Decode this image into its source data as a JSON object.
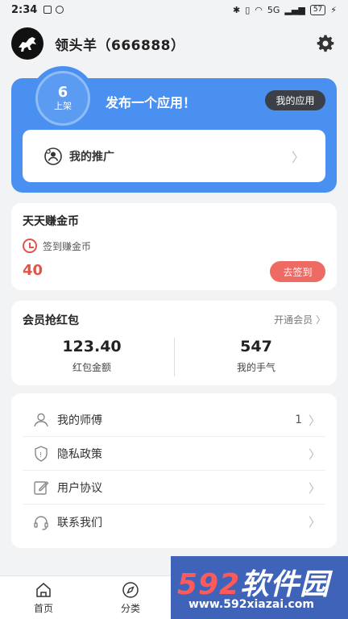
{
  "status_bar": {
    "time": "2:34",
    "battery": "57",
    "network": "5G"
  },
  "header": {
    "username": "领头羊（666888）"
  },
  "promo": {
    "count": "6",
    "count_label": "上架",
    "publish_text": "发布一个应用！",
    "my_apps_button": "我的应用",
    "promotion_label": "我的推广"
  },
  "coins": {
    "title": "天天赚金币",
    "signin_label": "签到赚金币",
    "value": "40",
    "go_button": "去签到"
  },
  "vip": {
    "title": "会员抢红包",
    "open_link": "开通会员",
    "red_packet_amount": "123.40",
    "red_packet_label": "红包金额",
    "luck_value": "547",
    "luck_label": "我的手气"
  },
  "menu": {
    "items": [
      {
        "label": "我的师傅",
        "extra": "1",
        "icon": "user-icon"
      },
      {
        "label": "隐私政策",
        "extra": "",
        "icon": "shield-icon"
      },
      {
        "label": "用户协议",
        "extra": "",
        "icon": "edit-icon"
      },
      {
        "label": "联系我们",
        "extra": "",
        "icon": "headset-icon"
      }
    ]
  },
  "bottom_nav": {
    "items": [
      {
        "label": "首页",
        "icon": "home-icon"
      },
      {
        "label": "分类",
        "icon": "compass-icon"
      }
    ]
  },
  "watermark": {
    "brand_num": "592",
    "brand_text": "软件园",
    "url": "www.592xiazai.com"
  },
  "colors": {
    "primary_blue": "#4a90f0",
    "accent_red": "#e0544b",
    "dark_button": "#3b3f47"
  }
}
